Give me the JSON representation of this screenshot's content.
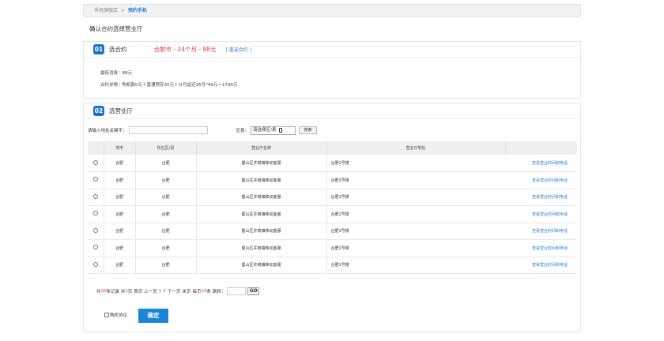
{
  "breadcrumb": {
    "home": "手机旗舰店",
    "separator": ">",
    "current": "预约手机"
  },
  "page_title": "确认合约选择营业厅",
  "step1": {
    "num": "01",
    "title": "选合约",
    "plan": "合肥市 - 24个月 - 88元",
    "reselect": "[ 重选合约 ]",
    "min_fee": "最低消费：88元",
    "detail": "合约详情：购机款0元＋普通预存35元＋分月返还36月*49元＝1799元"
  },
  "step2": {
    "num": "02",
    "title": "选营业厅",
    "search_label": "请输入地址关键字：",
    "search_value": "",
    "district_label": "区县：",
    "district_value": "请选择区/县",
    "search_button": "搜索"
  },
  "table": {
    "headers": [
      "",
      "地市",
      "所在区/县",
      "营业厅名称",
      "营业厅地址",
      ""
    ],
    "rows": [
      {
        "city": "合肥",
        "district": "合肥",
        "name": "蜀山区井岗镇移动客服",
        "address": "合肥1号楼",
        "link": "查看营业时间和电话"
      },
      {
        "city": "合肥",
        "district": "合肥",
        "name": "蜀山区井岗镇移动客服",
        "address": "合肥1号楼",
        "link": "查看营业时间和电话"
      },
      {
        "city": "合肥",
        "district": "合肥",
        "name": "蜀山区井岗镇移动客服",
        "address": "合肥1号楼",
        "link": "查看营业时间和电话"
      },
      {
        "city": "合肥",
        "district": "合肥",
        "name": "蜀山区井岗镇移动客服",
        "address": "合肥1号楼",
        "link": "查看营业时间和电话"
      },
      {
        "city": "合肥",
        "district": "合肥",
        "name": "蜀山区井岗镇移动客服",
        "address": "合肥1号楼",
        "link": "查看营业时间和电话"
      },
      {
        "city": "合肥",
        "district": "合肥",
        "name": "蜀山区井岗镇移动客服",
        "address": "合肥1号楼",
        "link": "查看营业时间和电话"
      },
      {
        "city": "合肥",
        "district": "合肥",
        "name": "蜀山区井岗镇移动客服",
        "address": "合肥1号楼",
        "link": "查看营业时间和电话"
      }
    ]
  },
  "pager": {
    "total_pre": "共",
    "total_records": "20",
    "total_mid": "条记录 共",
    "total_pages": "2",
    "total_post": "页",
    "first": "首页",
    "prev": "上一页",
    "page1": "1",
    "page2": "2",
    "next": "下一页",
    "last": "末页",
    "per_page_pre": "每页",
    "per_page": "10",
    "per_page_post": "条",
    "jump_label": "跳转：",
    "go": "GO"
  },
  "agreement_label": "购机协议",
  "confirm_button": "确定",
  "colors": {
    "accent": "#1a73c9",
    "price_red": "#e23b3b",
    "link_blue": "#2a7fd0"
  }
}
